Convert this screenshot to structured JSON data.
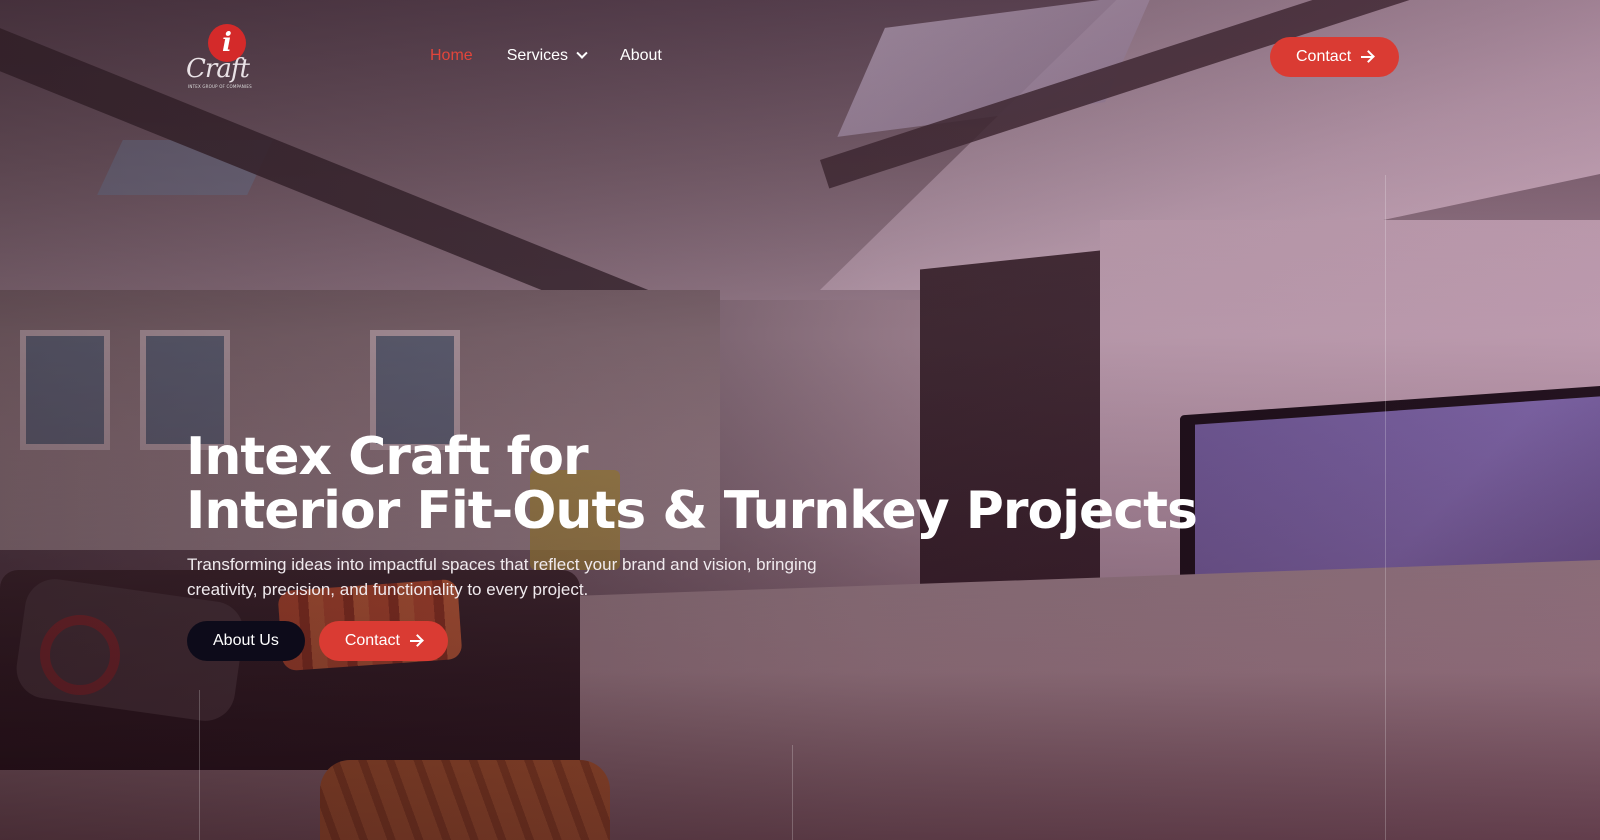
{
  "brand": {
    "logo_letter": "i",
    "logo_word": "Craft",
    "logo_tagline": "INTEX GROUP OF COMPANIES",
    "accent_color": "#da3b33"
  },
  "nav": {
    "items": [
      {
        "label": "Home",
        "active": true
      },
      {
        "label": "Services",
        "has_dropdown": true,
        "dropdown_icon": "chevron-down-icon"
      },
      {
        "label": "About"
      }
    ]
  },
  "header_cta": {
    "label": "Contact",
    "icon": "arrow-right-icon"
  },
  "hero": {
    "title_line1": "Intex Craft for",
    "title_line2": "Interior Fit-Outs & Turnkey Projects",
    "subtitle": "Transforming ideas into impactful spaces that reflect your brand and vision, bringing creativity, precision, and functionality to every project.",
    "primary_button": "About Us",
    "secondary_button": "Contact",
    "secondary_button_icon": "arrow-right-icon"
  }
}
